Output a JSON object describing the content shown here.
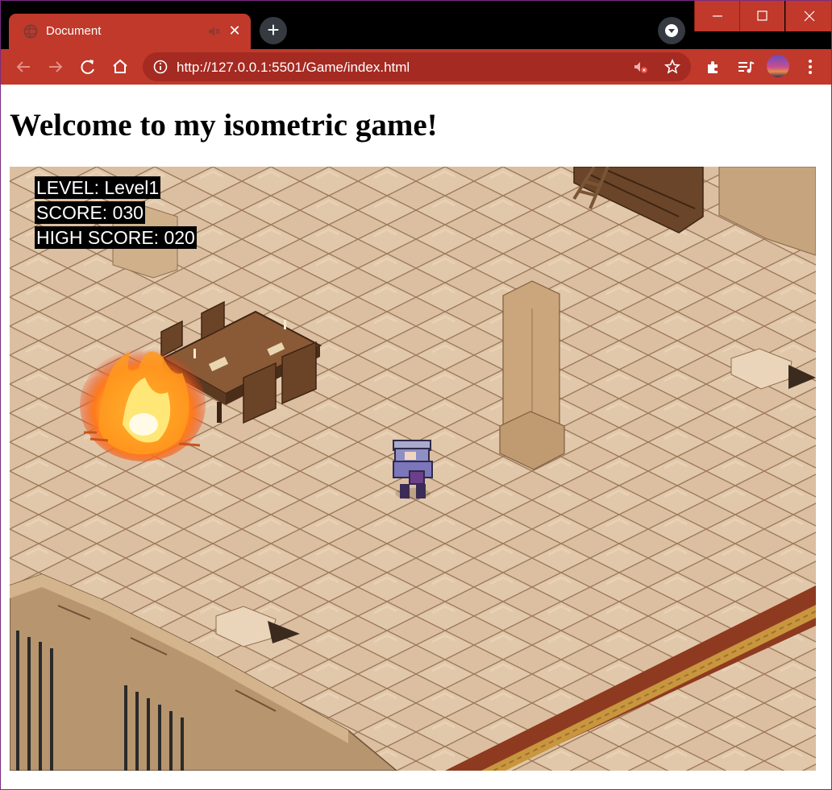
{
  "browser": {
    "tab": {
      "title": "Document"
    },
    "address_bar": {
      "url": "http://127.0.0.1:5501/Game/index.html"
    },
    "icons": [
      "globe-icon",
      "mute-icon",
      "close-icon",
      "plus-icon",
      "tab-search-icon",
      "minimize-icon",
      "maximize-icon",
      "window-close-icon",
      "back-icon",
      "forward-icon",
      "reload-icon",
      "home-icon",
      "info-icon",
      "bookmark-star-icon",
      "extensions-icon",
      "media-queue-icon",
      "kebab-menu-icon"
    ],
    "accent_color": "#c0392b"
  },
  "page": {
    "heading": "Welcome to my isometric game!"
  },
  "game": {
    "hud": {
      "level": "LEVEL: Level1",
      "score": "SCORE: 030",
      "high_score": "HIGH SCORE: 020"
    }
  }
}
